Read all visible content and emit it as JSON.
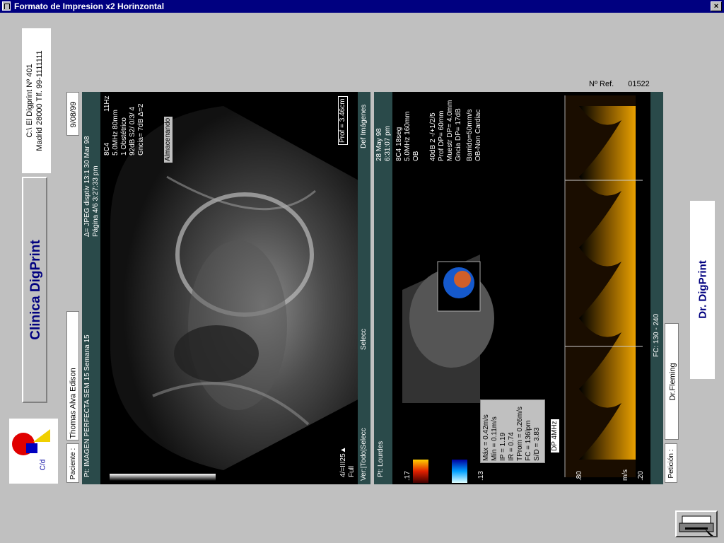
{
  "window": {
    "title": "Formato de Impresion x2 Horinzontal",
    "close_label": "×"
  },
  "clinic": {
    "address_line1": "C:\\ El Digprint  Nº 401",
    "address_line2": "Madrid 28000 Tlf. 99-1111111",
    "name": "Clinica DigPrint",
    "logo_text": "C/d"
  },
  "patient": {
    "label": "Paciente :",
    "name": "Thomas Alva Edison",
    "date": "9/08/99"
  },
  "reference": {
    "label": "Nº Ref.",
    "value": "01522"
  },
  "request": {
    "label": "Petición :",
    "doctor": "Dr.Fleming"
  },
  "doctor_card": {
    "name": "Dr. DigPrint"
  },
  "image1": {
    "header_left": "Pt: IMAGEN PERFECTA SEM 15  Semana 15",
    "header_right": "Δ= JPEG disptiv 13:1  30 Mar 98",
    "header_right2": "Página 4/6   3:27:33 pm",
    "params": [
      "8C4",
      "5.0MHz   80mm",
      "1 Obstétrico",
      "92dB  S2/ 0/3/ 4",
      "Gncia=  7dB  Δ=2"
    ],
    "status": "Almacenando",
    "prof": "Prof = 3.46cm",
    "footer1": "Ver:|Todo|Selecc",
    "footer2": "Selecc",
    "footer3": "Def Imágenes",
    "corner": "4/=III25▲",
    "corner2": "Full",
    "freq": "11Hz"
  },
  "image2": {
    "header_left": "Pt: Lourdes",
    "header_right": "28 May 98",
    "header_right2": "6:31:07 pm",
    "params": [
      "8C4        18seg",
      "5.0MHz    160mm",
      "OB",
      "40dB  2 -/+1/2/5",
      "Prof DP= 60mm",
      "Muestr DP= 4.0mm",
      "Gncia DP= 17dB",
      "Barrido=50mm/s",
      "OB-Non Cardiac"
    ],
    "measurements": [
      "Máx = 0.42m/s",
      "Mín = 0.11m/s",
      "IP = 1.19",
      "IR = 0.74",
      "TProm = 0.26m/s",
      "FC = 136lpm",
      "S/D = 3.83"
    ],
    "scale_top": ".17",
    "scale_bottom": ".13",
    "axis_label": "m/s",
    "axis_80": ".80",
    "axis_20": ".20",
    "fc": "FC: 130 - 240",
    "dp_label": "DP 4MHz"
  }
}
